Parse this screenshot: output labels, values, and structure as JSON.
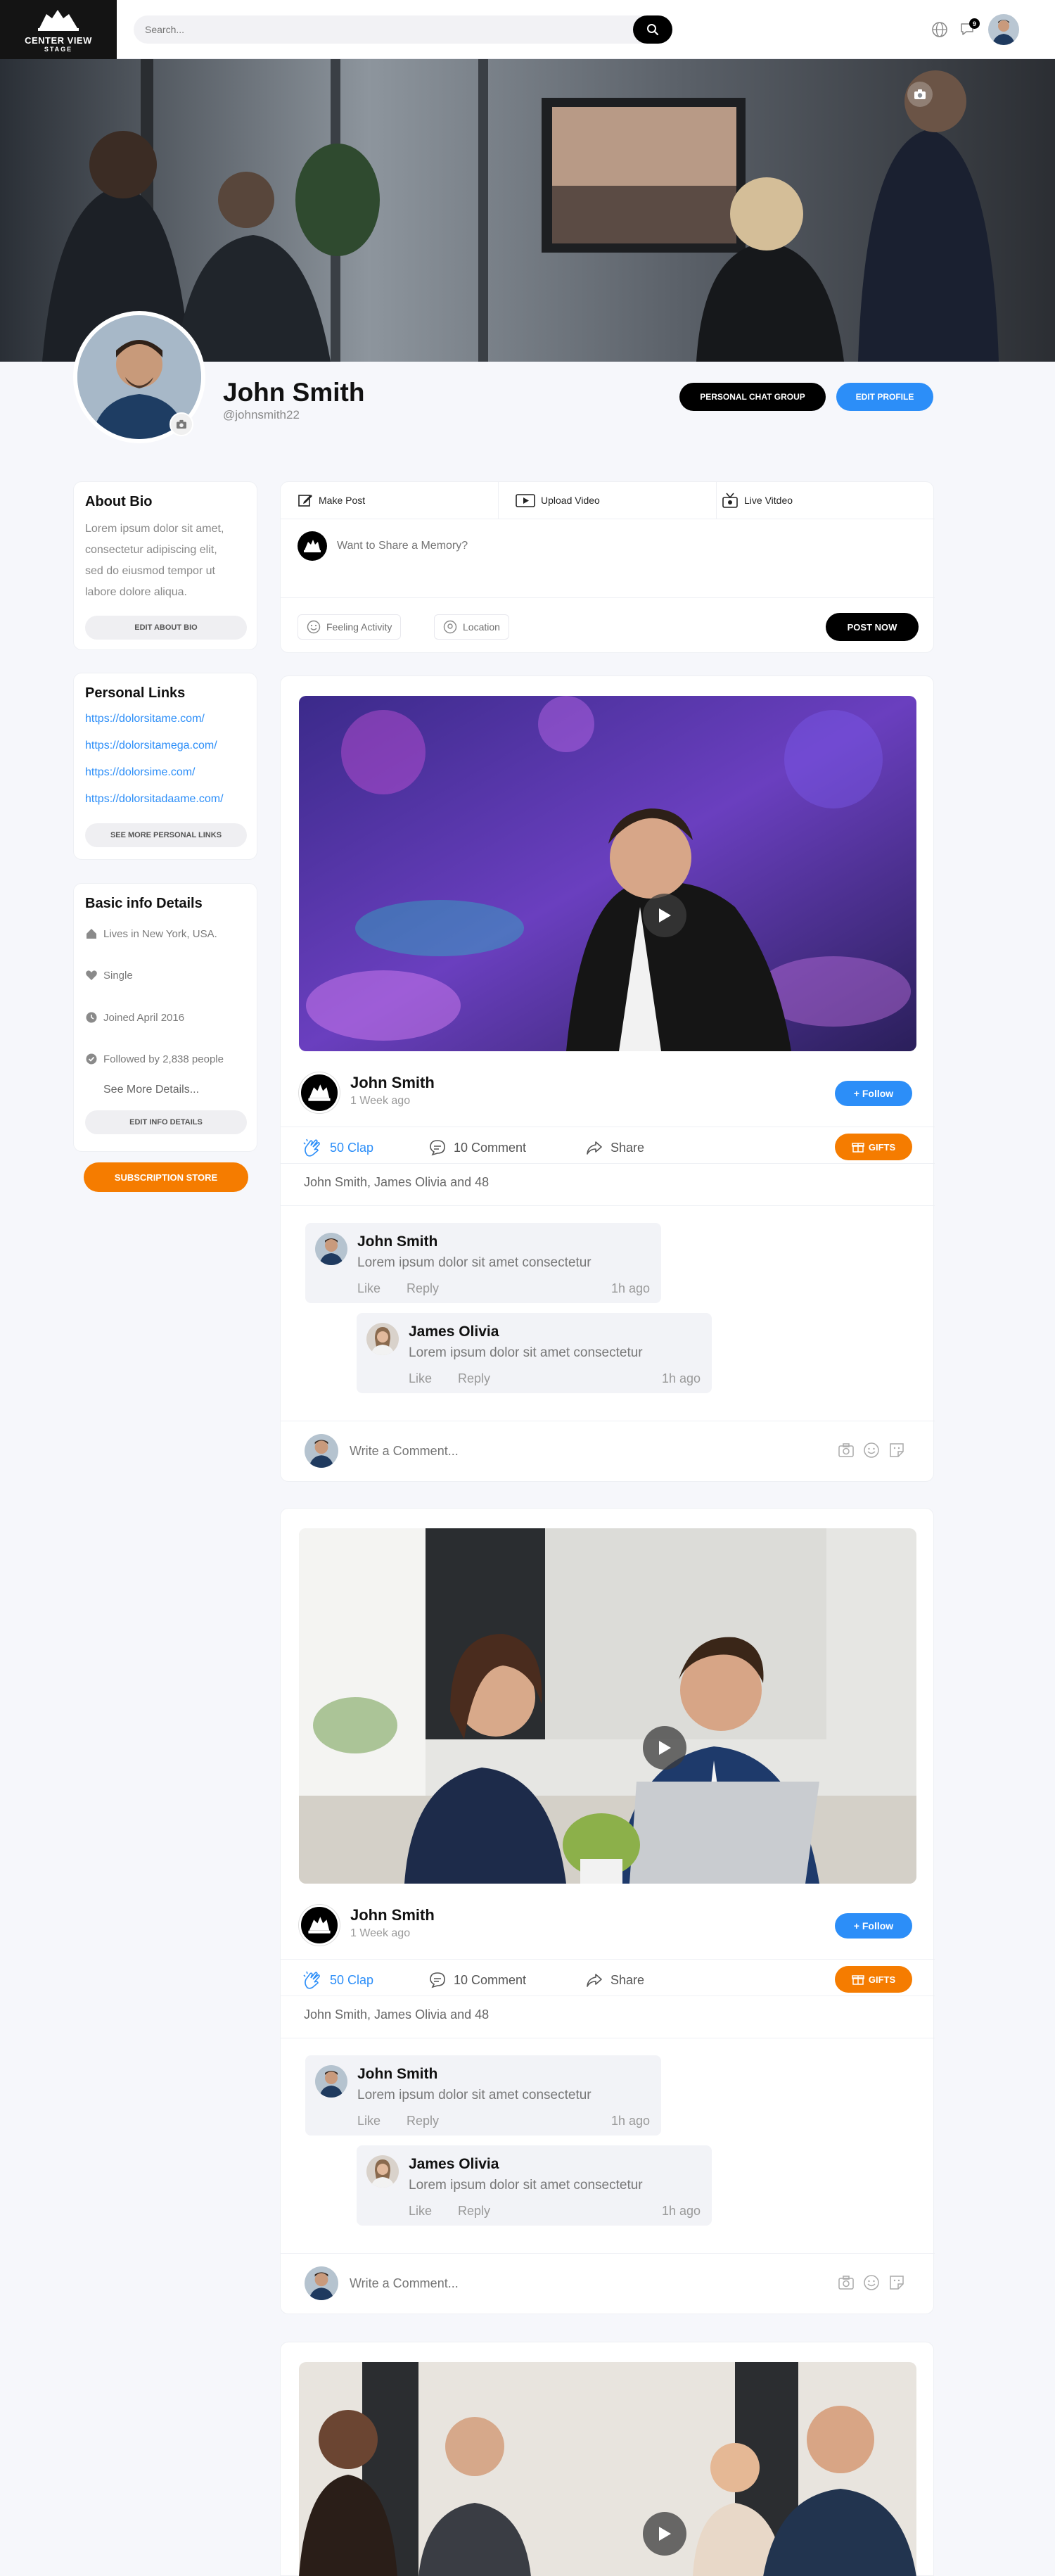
{
  "header": {
    "logo_line1": "CENTER VIEW",
    "logo_line2": "STAGE",
    "search_placeholder": "Search...",
    "notification_count": "9"
  },
  "profile": {
    "name": "John Smith",
    "handle": "@johnsmith22",
    "chat_button": "PERSONAL CHAT GROUP",
    "edit_button": "EDIT PROFILE"
  },
  "sidebar": {
    "bio": {
      "title": "About Bio",
      "lines": [
        "Lorem ipsum dolor sit amet,",
        "consectetur adipiscing elit,",
        "sed do eiusmod tempor ut",
        "labore dolore aliqua."
      ],
      "button": "EDIT ABOUT BIO"
    },
    "links": {
      "title": "Personal Links",
      "items": [
        "https://dolorsitame.com/",
        "https://dolorsitamega.com/",
        "https://dolorsime.com/",
        "https://dolorsitadaame.com/"
      ],
      "button": "SEE MORE PERSONAL LINKS"
    },
    "info": {
      "title": "Basic info Details",
      "items": [
        "Lives in New York, USA.",
        "Single",
        "Joined April 2016",
        "Followed by 2,838 people"
      ],
      "see_more": "See More Details...",
      "button": "EDIT INFO DETAILS"
    },
    "subscription": "SUBSCRIPTION STORE"
  },
  "composer": {
    "tabs": [
      "Make Post",
      "Upload Video",
      "Live Vitdeo"
    ],
    "placeholder": "Want to Share a Memory?",
    "chips": [
      "Feeling Activity",
      "Location"
    ],
    "post_button": "POST NOW"
  },
  "posts": [
    {
      "author": "John Smith",
      "time": "1 Week ago",
      "follow": "+ Follow",
      "claps": "50 Clap",
      "comments": "10 Comment",
      "share": "Share",
      "gifts": "GIFTS",
      "reactions": "John Smith, James Olivia and 48",
      "comment1": {
        "name": "John Smith",
        "text": "Lorem ipsum dolor sit amet consectetur",
        "like": "Like",
        "reply": "Reply",
        "ago": "1h ago"
      },
      "comment2": {
        "name": "James Olivia",
        "text": "Lorem ipsum dolor sit amet consectetur",
        "like": "Like",
        "reply": "Reply",
        "ago": "1h ago"
      },
      "write_placeholder": "Write a Comment..."
    },
    {
      "author": "John Smith",
      "time": "1 Week ago",
      "follow": "+ Follow",
      "claps": "50 Clap",
      "comments": "10 Comment",
      "share": "Share",
      "gifts": "GIFTS",
      "reactions": "John Smith, James Olivia and 48",
      "comment1": {
        "name": "John Smith",
        "text": "Lorem ipsum dolor sit amet consectetur",
        "like": "Like",
        "reply": "Reply",
        "ago": "1h ago"
      },
      "comment2": {
        "name": "James Olivia",
        "text": "Lorem ipsum dolor sit amet consectetur",
        "like": "Like",
        "reply": "Reply",
        "ago": "1h ago"
      },
      "write_placeholder": "Write a Comment..."
    }
  ],
  "colors": {
    "accent_blue": "#2c8ef8",
    "accent_orange": "#f57c00",
    "black": "#000000"
  }
}
